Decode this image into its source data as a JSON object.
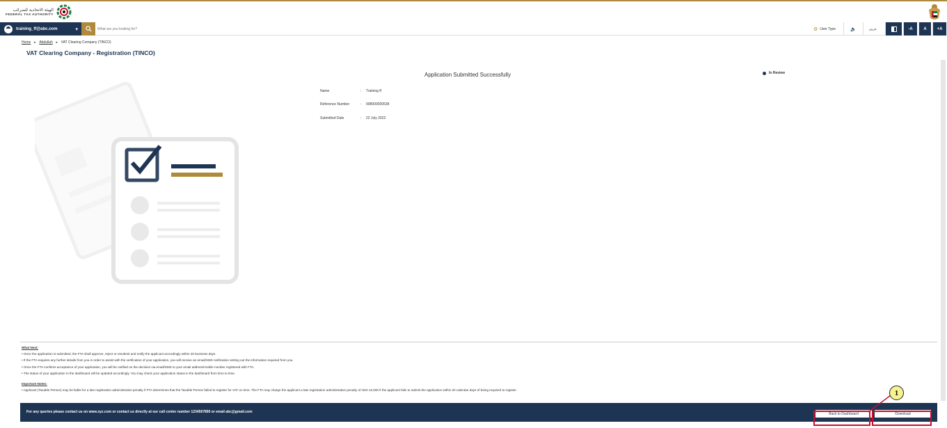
{
  "header": {
    "logo_ar": "الهيئة الاتحادية للضرائب",
    "logo_en": "FEDERAL TAX AUTHORITY",
    "emblem_icon": "uae-emblem-icon"
  },
  "navbar": {
    "user_email": "training_ff@abc.com",
    "search_placeholder": "What are you looking for?",
    "user_type_label": "User Type",
    "language_label": "عربي",
    "font_decrease": "-A",
    "font_normal": "A",
    "font_increase": "+A"
  },
  "breadcrumb": {
    "home": "Home",
    "user": "Abdullah",
    "current": "VAT Clearing Company (TINCO)"
  },
  "page": {
    "title": "VAT Clearing Company - Registration (TINCO)",
    "success_message": "Application Submitted Successfully",
    "status": "In Review",
    "status_color": "#1e3453"
  },
  "details": {
    "name_label": "Name",
    "name_value": "Training ff",
    "ref_label": "Reference Number",
    "ref_value": "908000000538",
    "date_label": "Submitted Date",
    "date_value": "22 July 2022"
  },
  "notes": {
    "what_next_heading": "What Next:",
    "what_next": [
      "• Once the application is submitted, the FTA shall approve, reject or resubmit and notify the applicant accordingly within 20 business days.",
      "• If the FTA requires any further details from you in order to assist with the verification of your application, you will receive an email/SMS notification setting out the information required from you.",
      "• Once the FTA confirms acceptance of your application, you will be notified on the decision via email/SMS to your email address/mobile number registered with FTA.",
      "• The status of your application in the dashboard will be updated accordingly. You may check your application status in the dashboard from time to time."
    ],
    "important_heading": "Important Notes:",
    "important": [
      "• Applicant (Taxable Person) may be liable for a late registration administrative penalty if FTA determines that the Taxable Person failed to register for VAT on time. The FTA may charge the applicant a late registration administrative penalty of AED 10,000 if the applicant fails to submit the application within 30 calendar days of being required to register."
    ]
  },
  "footer": {
    "contact_text": "For any queries please contact us on www.xyz.com or contact us directly at our call center number 1234567890 or email abc@gmail.com",
    "back_button": "Back to Dashboard",
    "download_button": "Download"
  },
  "callout": {
    "number": "1",
    "color": "#c8102e"
  },
  "colors": {
    "navy": "#1e3453",
    "gold": "#b08a3c"
  }
}
